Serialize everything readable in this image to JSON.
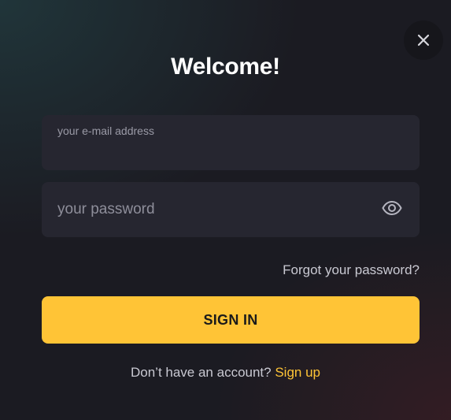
{
  "modal": {
    "title": "Welcome!",
    "close_icon": "close-icon"
  },
  "email": {
    "label": "your e-mail address",
    "value": ""
  },
  "password": {
    "placeholder": "your password",
    "value": "",
    "toggle_icon": "eye-icon"
  },
  "links": {
    "forgot": "Forgot your password?"
  },
  "signin": {
    "label": "SIGN IN"
  },
  "signup": {
    "prompt": "Don’t have an account?",
    "link": "Sign up"
  },
  "colors": {
    "accent": "#ffc436",
    "background": "#1b1b22",
    "field_background": "#262630",
    "text_primary": "#ffffff",
    "text_muted": "#c9c9d2"
  }
}
